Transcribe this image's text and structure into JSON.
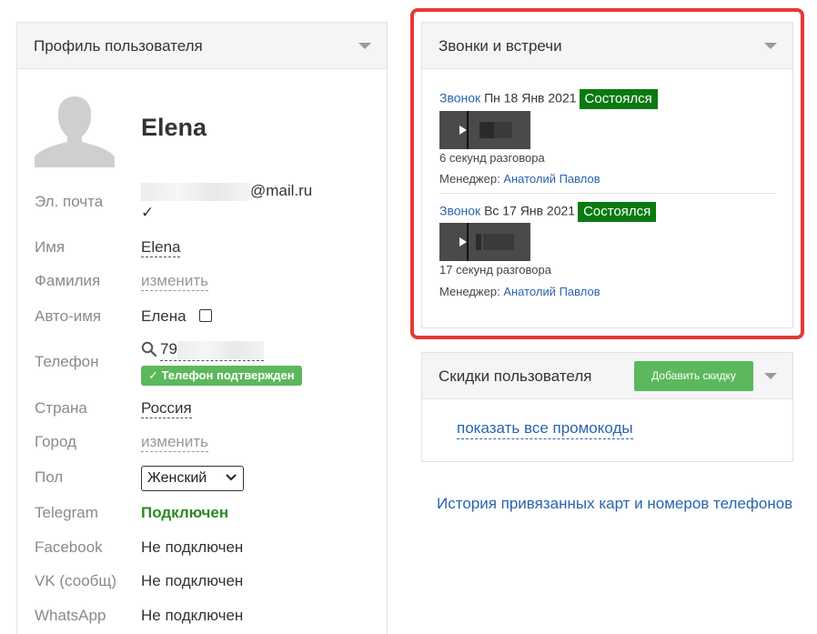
{
  "profile": {
    "title": "Профиль пользователя",
    "user_name": "Elena",
    "email_label": "Эл. почта",
    "email_suffix": "@mail.ru",
    "email_verified_mark": "✓",
    "first_name_label": "Имя",
    "first_name_value": "Elena",
    "last_name_label": "Фамилия",
    "last_name_value": "изменить",
    "auto_name_label": "Авто-имя",
    "auto_name_value": "Елена",
    "phone_label": "Телефон",
    "phone_prefix": "79",
    "phone_confirmed": "Телефон подтвержден",
    "country_label": "Страна",
    "country_value": "Россия",
    "city_label": "Город",
    "city_value": "изменить",
    "gender_label": "Пол",
    "gender_value": "Женский",
    "telegram_label": "Telegram",
    "telegram_value": "Подключен",
    "facebook_label": "Facebook",
    "facebook_value": "Не подключен",
    "vk_label": "VK (сообщ)",
    "vk_value": "Не подключен",
    "whatsapp_label": "WhatsApp",
    "whatsapp_value": "Не подключен"
  },
  "calls": {
    "title": "Звонки и встречи",
    "items": [
      {
        "type": "Звонок",
        "date": "Пн 18 Янв 2021",
        "status": "Состоялся",
        "duration": "6 секунд разговора",
        "manager_label": "Менеджер:",
        "manager_name": "Анатолий Павлов"
      },
      {
        "type": "Звонок",
        "date": "Вс 17 Янв 2021",
        "status": "Состоялся",
        "duration": "17 секунд разговора",
        "manager_label": "Менеджер:",
        "manager_name": "Анатолий Павлов"
      }
    ]
  },
  "discounts": {
    "title": "Скидки пользователя",
    "add_button": "Добавить скидку",
    "show_promos": "показать все промокоды"
  },
  "history_link": "История привязанных карт и номеров телефонов",
  "colors": {
    "accent_green": "#5cb85c",
    "status_green": "#0a7a10",
    "link_blue": "#2a64ad",
    "highlight_red": "#e53935"
  }
}
